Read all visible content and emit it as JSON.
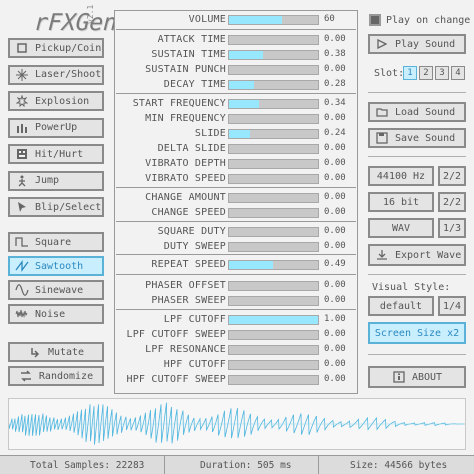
{
  "app": {
    "name": "rFXGen",
    "version": "v2.1"
  },
  "generators": [
    {
      "label": "Pickup/Coin",
      "icon": "coin-icon"
    },
    {
      "label": "Laser/Shoot",
      "icon": "laser-icon"
    },
    {
      "label": "Explosion",
      "icon": "explosion-icon"
    },
    {
      "label": "PowerUp",
      "icon": "powerup-icon"
    },
    {
      "label": "Hit/Hurt",
      "icon": "hit-icon"
    },
    {
      "label": "Jump",
      "icon": "jump-icon"
    },
    {
      "label": "Blip/Select",
      "icon": "blip-icon"
    }
  ],
  "waveforms": [
    {
      "label": "Square",
      "icon": "square-wave-icon",
      "active": false
    },
    {
      "label": "Sawtooth",
      "icon": "sawtooth-wave-icon",
      "active": true
    },
    {
      "label": "Sinewave",
      "icon": "sine-wave-icon",
      "active": false
    },
    {
      "label": "Noise",
      "icon": "noise-wave-icon",
      "active": false
    }
  ],
  "actions": {
    "mutate": "Mutate",
    "randomize": "Randomize"
  },
  "params": [
    {
      "label": "VOLUME",
      "value": 0.6,
      "text": "60"
    },
    {
      "label": "ATTACK TIME",
      "value": 0,
      "text": "0.00"
    },
    {
      "label": "SUSTAIN TIME",
      "value": 0.38,
      "text": "0.38"
    },
    {
      "label": "SUSTAIN PUNCH",
      "value": 0,
      "text": "0.00"
    },
    {
      "label": "DECAY TIME",
      "value": 0.28,
      "text": "0.28"
    },
    {
      "label": "START FREQUENCY",
      "value": 0.34,
      "text": "0.34"
    },
    {
      "label": "MIN FREQUENCY",
      "value": 0,
      "text": "0.00"
    },
    {
      "label": "SLIDE",
      "value": 0.24,
      "text": "0.24"
    },
    {
      "label": "DELTA SLIDE",
      "value": 0,
      "text": "0.00"
    },
    {
      "label": "VIBRATO DEPTH",
      "value": 0,
      "text": "0.00"
    },
    {
      "label": "VIBRATO SPEED",
      "value": 0,
      "text": "0.00"
    },
    {
      "label": "CHANGE AMOUNT",
      "value": 0,
      "text": "0.00"
    },
    {
      "label": "CHANGE SPEED",
      "value": 0,
      "text": "0.00"
    },
    {
      "label": "SQUARE DUTY",
      "value": 0,
      "text": "0.00"
    },
    {
      "label": "DUTY SWEEP",
      "value": 0,
      "text": "0.00"
    },
    {
      "label": "REPEAT SPEED",
      "value": 0.49,
      "text": "0.49"
    },
    {
      "label": "PHASER OFFSET",
      "value": 0,
      "text": "0.00"
    },
    {
      "label": "PHASER SWEEP",
      "value": 0,
      "text": "0.00"
    },
    {
      "label": "LPF CUTOFF",
      "value": 1.0,
      "text": "1.00"
    },
    {
      "label": "LPF CUTOFF SWEEP",
      "value": 0,
      "text": "0.00"
    },
    {
      "label": "LPF RESONANCE",
      "value": 0,
      "text": "0.00"
    },
    {
      "label": "HPF CUTOFF",
      "value": 0,
      "text": "0.00"
    },
    {
      "label": "HPF CUTOFF SWEEP",
      "value": 0,
      "text": "0.00"
    }
  ],
  "right": {
    "play_on_change": "Play on change",
    "play_sound": "Play Sound",
    "slot_label": "Slot:",
    "slots": [
      "1",
      "2",
      "3",
      "4"
    ],
    "active_slot": "1",
    "load_sound": "Load Sound",
    "save_sound": "Save Sound",
    "sample_rate": "44100 Hz",
    "sample_rate_step": "2/2",
    "bit_depth": "16 bit",
    "bit_depth_step": "2/2",
    "format": "WAV",
    "format_step": "1/3",
    "export_wave": "Export Wave",
    "visual_style_label": "Visual Style:",
    "style": "default",
    "style_step": "1/4",
    "screen_size": "Screen Size x2",
    "about": "ABOUT"
  },
  "status": {
    "total_samples": "Total Samples: 22283",
    "duration": "Duration: 505 ms",
    "size": "Size: 44566 bytes"
  },
  "colors": {
    "accent_fill": "#97e8ff",
    "accent_border": "#5bb2d9",
    "accent_text": "#2b89bf",
    "wave": "#4fb6df"
  }
}
